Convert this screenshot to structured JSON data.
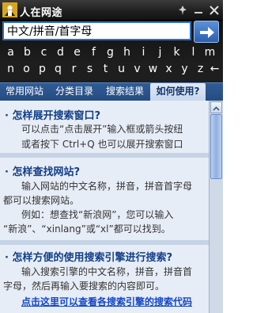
{
  "window": {
    "title": "人在网途"
  },
  "search": {
    "value": "中文/拼音/首字母"
  },
  "keyboard": {
    "row1": [
      "a",
      "b",
      "c",
      "d",
      "e",
      "f",
      "g",
      "h",
      "i",
      "j",
      "k",
      "l",
      "m"
    ],
    "row2": [
      "n",
      "o",
      "p",
      "q",
      "r",
      "s",
      "t",
      "u",
      "v",
      "w",
      "x",
      "y",
      "z",
      "←"
    ]
  },
  "tabs": [
    {
      "label": "常用网站"
    },
    {
      "label": "分类目录"
    },
    {
      "label": "搜索结果"
    },
    {
      "label": "如何使用?"
    }
  ],
  "help": {
    "s1": {
      "title": "· 怎样展开搜索窗口?",
      "lines": [
        "可以点击“点击展开”输入框或箭头按纽",
        "或者按下 Ctrl+Q 也可以展开搜索窗口"
      ]
    },
    "s2": {
      "title": "· 怎样查找网站?",
      "lines": [
        "输入网站的中文名称，拼音，拼音首字母",
        "都可以搜索网站。",
        "例如：想查找“新浪网”，您可以输入",
        "“新浪”、“xinlang”或“xl”都可以找到。"
      ]
    },
    "s3": {
      "title": "· 怎样方便的使用搜索引擎进行搜索?",
      "lines": [
        "输入搜索引擎的中文名称，拼音，拼音首",
        "字母，然后再输入要搜索的内容即可。"
      ],
      "link": "点击这里可以查看各搜索引擎的搜索代码"
    }
  },
  "colors": {
    "accent": "#2f6fc0",
    "tab_bar": "#2a5289",
    "title_text": "#123f86"
  }
}
